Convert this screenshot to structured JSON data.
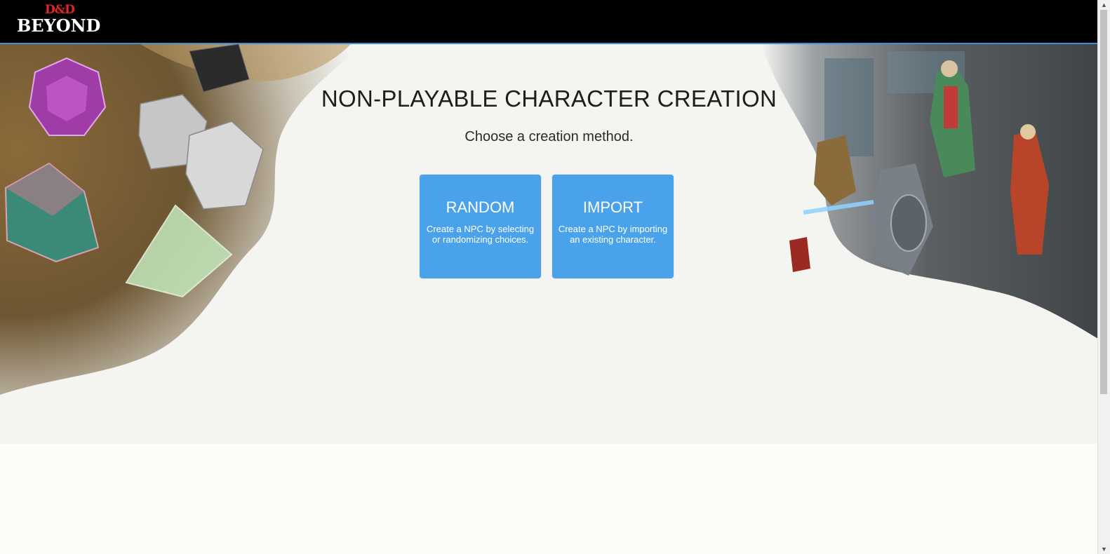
{
  "header": {
    "logo_top": "D&D",
    "logo_bottom": "BEYOND"
  },
  "main": {
    "title": "NON-PLAYABLE CHARACTER CREATION",
    "subtitle": "Choose a creation method.",
    "methods": [
      {
        "label": "RANDOM",
        "description": "Create a NPC by selecting or randomizing choices."
      },
      {
        "label": "IMPORT",
        "description": "Create a NPC by importing an existing character."
      }
    ]
  },
  "colors": {
    "accent": "#4aa3ea",
    "header_bg": "#000000",
    "logo_red": "#e8232a",
    "header_border": "#3f8fd6"
  },
  "icons": {
    "scroll_up": "chevron-up-icon",
    "scroll_down": "chevron-down-icon"
  }
}
